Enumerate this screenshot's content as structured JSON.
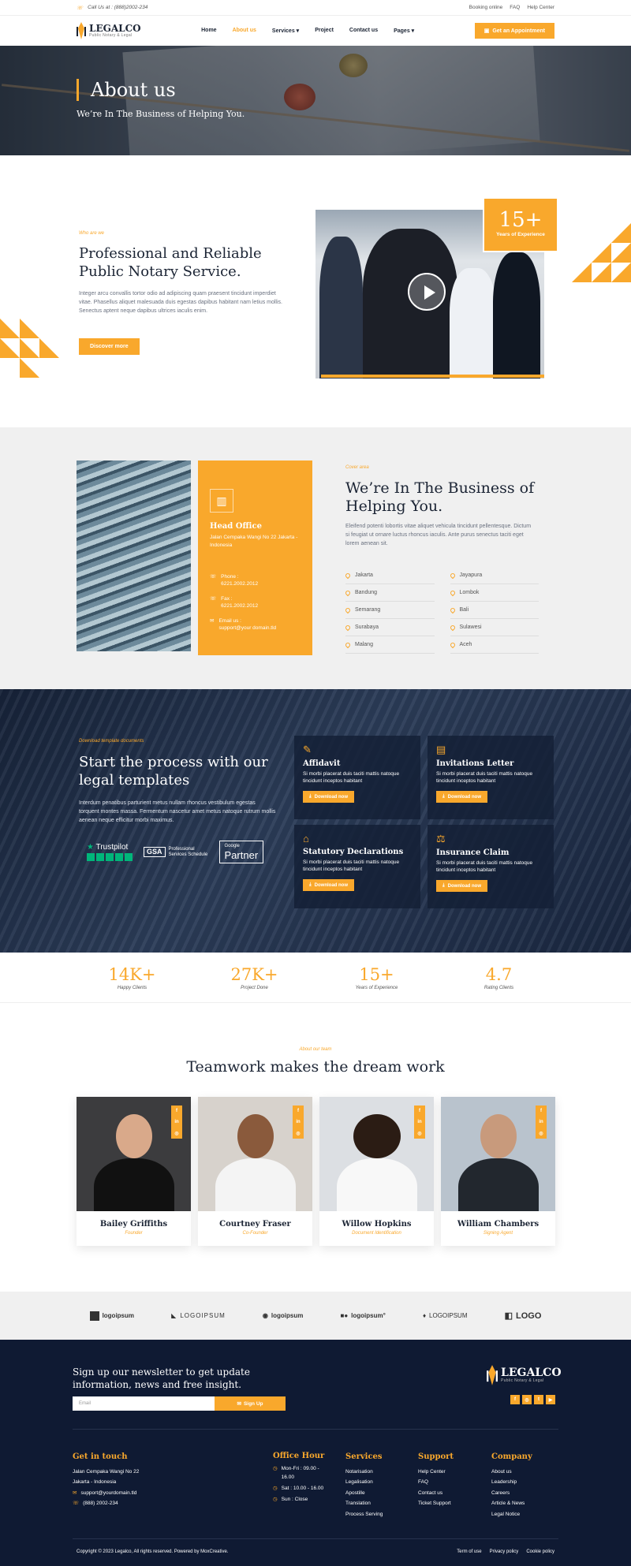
{
  "topbar": {
    "call": "Call Us at : (888)2002-234",
    "links": [
      "Booking online",
      "FAQ",
      "Help Center"
    ]
  },
  "brand": {
    "name": "LEGALCO",
    "tagline": "Public Notary & Legal"
  },
  "nav": {
    "items": [
      "Home",
      "About us",
      "Services",
      "Project",
      "Contact us",
      "Pages"
    ],
    "active": "About us",
    "cta": "Get an Appointment"
  },
  "hero": {
    "title": "About us",
    "subtitle": "We’re In The Business of Helping You."
  },
  "about": {
    "eyebrow": "Who are we",
    "title": "Professional and Reliable Public Notary Service.",
    "description": "Integer arcu convallis tortor odio ad adipiscing quam praesent tincidunt imperdiet vitae. Phasellus aliquet malesuada duis egestas dapibus habitant nam letius mollis. Senectus aptent neque dapibus ultrices iaculis enim.",
    "button": "Discover more",
    "experience_value": "15+",
    "experience_label": "Years of Experience"
  },
  "offices": {
    "head": {
      "title": "Head Office",
      "address": "Jalan Cempaka Wangi No 22 Jakarta - Indonesia",
      "phone_label": "Phone :",
      "phone": "6221.2002.2012",
      "fax_label": "Fax :",
      "fax": "6221.2002.2012",
      "email_label": "Email us :",
      "email": "support@your domain.tld"
    },
    "eyebrow": "Cover area",
    "title": "We’re In The Business of Helping You.",
    "description": "Eleifend potenti lobortis vitae aliquet vehicula tincidunt pellentesque. Dictum si feugiat ut ornare luctus rhoncus iaculis. Ante purus senectus taciti eget lorem aenean sit.",
    "cities": [
      "Jakarta",
      "Jayapura",
      "Bandung",
      "Lombok",
      "Semarang",
      "Bali",
      "Surabaya",
      "Sulawesi",
      "Malang",
      "Aceh"
    ]
  },
  "templates": {
    "eyebrow": "Download template documents",
    "title": "Start the process with our legal templates",
    "description": "Interdum penatibus parturient metus nullam rhoncus vestibulum egestas torquent montes massa. Fermentum nascetur amet metus natoque rutrum mollis aenean neque efficitur morbi maximus.",
    "badges": {
      "trustpilot": "Trustpilot",
      "gsa": "GSA",
      "gsa_text": "Professional Services Schedule",
      "google_small": "Google",
      "google_big": "Partner"
    },
    "cards": [
      {
        "icon": "✎",
        "title": "Affidavit",
        "text": "Si morbi placerat duis taciti mattis natoque tincidunt inceptos habitant",
        "button": "Download now"
      },
      {
        "icon": "▤",
        "title": "Invitations Letter",
        "text": "Si morbi placerat duis taciti mattis natoque tincidunt inceptos habitant",
        "button": "Download now"
      },
      {
        "icon": "⌂",
        "title": "Statutory Declarations",
        "text": "Si morbi placerat duis taciti mattis natoque tincidunt inceptos habitant",
        "button": "Download now"
      },
      {
        "icon": "⚖",
        "title": "Insurance Claim",
        "text": "Si morbi placerat duis taciti mattis natoque tincidunt inceptos habitant",
        "button": "Download now"
      }
    ]
  },
  "stats": [
    {
      "value": "14K+",
      "label": "Happy Clients"
    },
    {
      "value": "27K+",
      "label": "Project Done"
    },
    {
      "value": "15+",
      "label": "Years of Experience"
    },
    {
      "value": "4.7",
      "label": "Rating Clients"
    }
  ],
  "team": {
    "eyebrow": "About our team",
    "title": "Teamwork makes the dream work",
    "social": [
      "f",
      "in",
      "◎"
    ],
    "members": [
      {
        "name": "Bailey Griffiths",
        "role": "Founder"
      },
      {
        "name": "Courtney Fraser",
        "role": "Co-Founder"
      },
      {
        "name": "Willow Hopkins",
        "role": "Document Identification"
      },
      {
        "name": "William Chambers",
        "role": "Signing Agent"
      }
    ]
  },
  "logos": [
    "logoipsum",
    "LOGOIPSUM",
    "logoipsum",
    "logoipsum°",
    "LOGOIPSUM",
    "LOGO"
  ],
  "footer": {
    "newsletter": "Sign up our newsletter to get update information, news and free insight.",
    "email_placeholder": "Email",
    "signup": "Sign Up",
    "social": [
      "f",
      "◎",
      "t",
      "▶"
    ],
    "contact": {
      "title": "Get in touch",
      "address1": "Jalan Cempaka Wangi No 22",
      "address2": "Jakarta - Indonesia",
      "email": "support@yourdomain.tld",
      "phone": "(888) 2002-234"
    },
    "hours": {
      "title": "Office Hour",
      "lines": [
        "Mon-Fri : 09.00 - 16.00",
        "Sat : 10.00 - 16.00",
        "Sun : Close"
      ]
    },
    "services": {
      "title": "Services",
      "items": [
        "Notarisation",
        "Legalisation",
        "Apostille",
        "Translation",
        "Process Serving"
      ]
    },
    "support": {
      "title": "Support",
      "items": [
        "Help Center",
        "FAQ",
        "Contact us",
        "Ticket Support"
      ]
    },
    "company": {
      "title": "Company",
      "items": [
        "About us",
        "Leadership",
        "Careers",
        "Article & News",
        "Legal Notice"
      ]
    },
    "copyright": "Copyright © 2023 Legalco, All rights reserved. Powered by MoxCreative.",
    "legal": [
      "Term of use",
      "Privacy policy",
      "Cookie policy"
    ]
  },
  "colors": {
    "accent": "#f9a82c",
    "dark": "#0f1a33"
  }
}
